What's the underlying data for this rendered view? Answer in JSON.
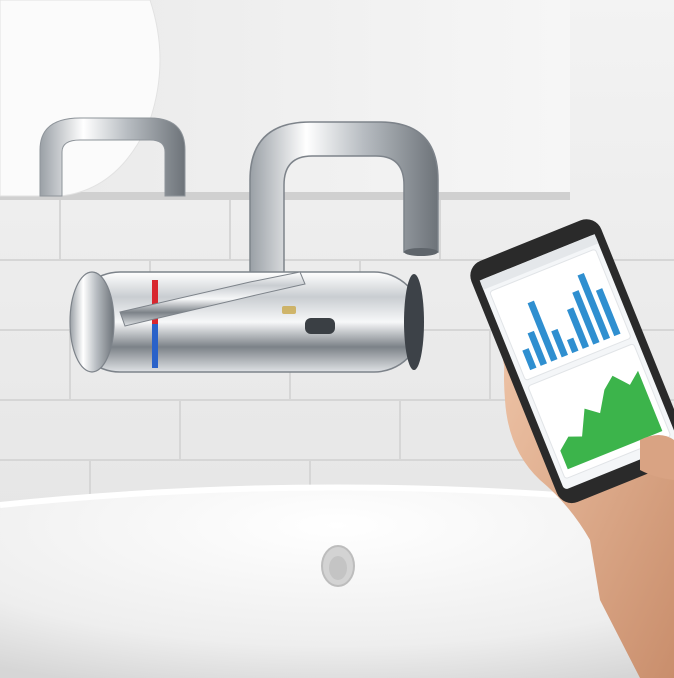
{
  "scene": {
    "description_alt": "",
    "colors": {
      "wall": "#eeeeee",
      "brick_line": "#d9d9d9",
      "chrome_light": "#f4f6f8",
      "chrome_dark": "#8a9096",
      "basin": "#f7f7f7",
      "phone_body": "#2a2a2a",
      "chart_bar": "#2f8fd0",
      "chart_area": "#3cb44b",
      "skin": "#e2b394",
      "hot_ring": "#d8262e",
      "cold_ring": "#2a62c9"
    },
    "icons": [
      "faucet",
      "sensor",
      "smartphone",
      "hand",
      "drain"
    ]
  },
  "phone": {
    "screen_card_1_title": "",
    "screen_card_2_title": "",
    "bar_chart": {
      "type": "bar",
      "values": [
        3,
        5,
        9,
        4,
        2,
        6,
        8,
        10,
        7
      ]
    },
    "area_chart": {
      "type": "area",
      "values": [
        2,
        3,
        2.5,
        5,
        4,
        6,
        7,
        5.5,
        6.5
      ]
    }
  }
}
